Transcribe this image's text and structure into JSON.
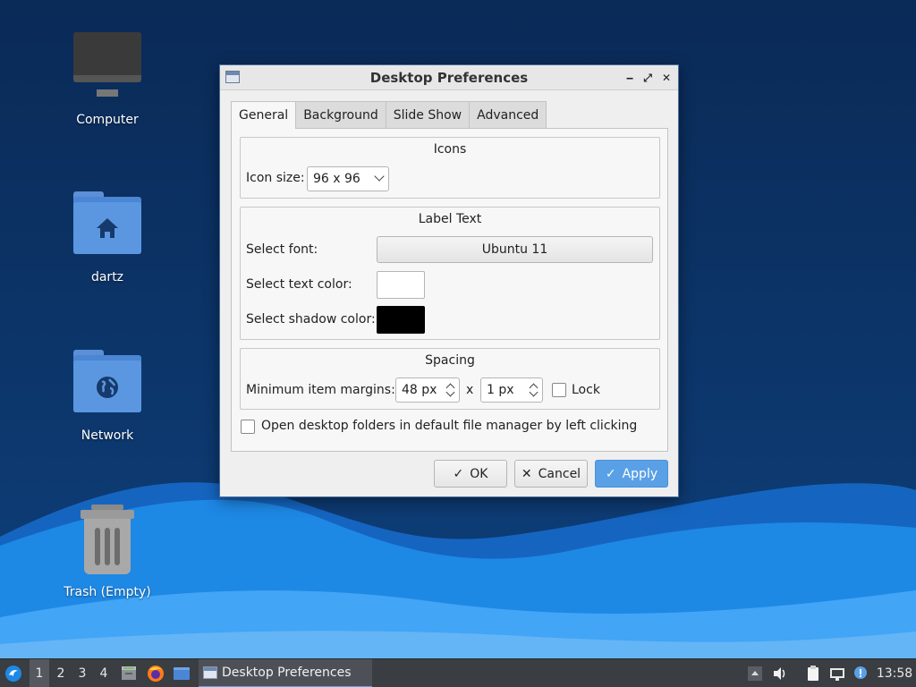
{
  "desktop": {
    "icons": [
      {
        "label": "Computer",
        "icon": "computer-icon"
      },
      {
        "label": "dartz",
        "icon": "home-folder-icon"
      },
      {
        "label": "Network",
        "icon": "network-folder-icon"
      },
      {
        "label": "Trash (Empty)",
        "icon": "trash-icon"
      }
    ]
  },
  "dialog": {
    "title": "Desktop Preferences",
    "controls": {
      "minimize": "‒",
      "maximize": "⤢",
      "close": "✕"
    },
    "tabs": [
      "General",
      "Background",
      "Slide Show",
      "Advanced"
    ],
    "active_tab": "General",
    "icons_group": {
      "title": "Icons",
      "icon_size_label": "Icon size:",
      "icon_size_value": "96 x 96"
    },
    "label_text_group": {
      "title": "Label Text",
      "font_label": "Select font:",
      "font_value": "Ubuntu 11",
      "text_color_label": "Select text color:",
      "text_color": "#ffffff",
      "shadow_color_label": "Select shadow color:",
      "shadow_color": "#000000"
    },
    "spacing_group": {
      "title": "Spacing",
      "margins_label": "Minimum item margins:",
      "margin_x": "48 px",
      "separator": "x",
      "margin_y": "1 px",
      "lock_label": "Lock",
      "lock_checked": false
    },
    "open_folders_label": "Open desktop folders in default file manager by left clicking",
    "open_folders_checked": false,
    "buttons": {
      "ok": "OK",
      "cancel": "Cancel",
      "apply": "Apply"
    }
  },
  "taskbar": {
    "workspaces": [
      "1",
      "2",
      "3",
      "4"
    ],
    "active_workspace": "1",
    "task_title": "Desktop Preferences",
    "clock": "13:58",
    "accent": "#5aa0e6"
  }
}
